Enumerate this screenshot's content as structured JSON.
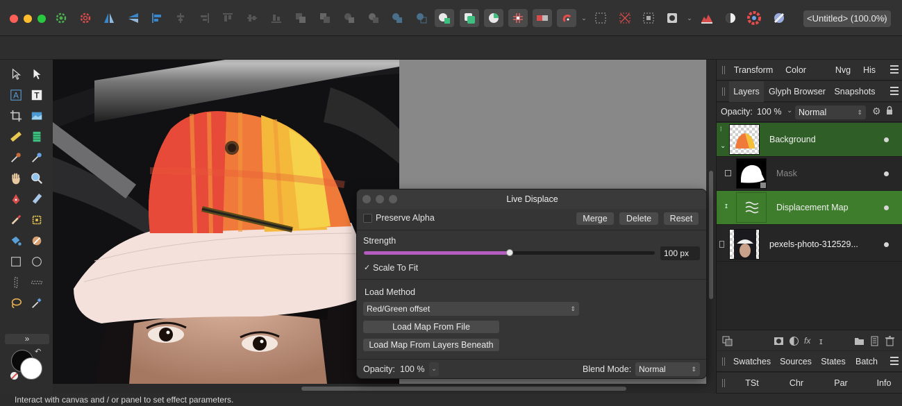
{
  "document_tab": {
    "title": "<Untitled> (100.0%)",
    "close": "×"
  },
  "status_bar": {
    "text": "Interact with canvas and / or panel to set effect parameters."
  },
  "tools_panel": {
    "expand_label": "»"
  },
  "right_panel": {
    "top_tabs": [
      "Transform",
      "Color",
      "Nvg",
      "His"
    ],
    "layers_tabs": [
      "Layers",
      "Glyph Browser",
      "Snapshots"
    ],
    "opacity_label": "Opacity:",
    "opacity_value": "100 %",
    "blend_value": "Normal",
    "layers": [
      {
        "name": "Background"
      },
      {
        "name": "Mask"
      },
      {
        "name": "Displacement Map"
      },
      {
        "name": "pexels-photo-312529..."
      }
    ],
    "bottom_tabs_1": [
      "Swatches",
      "Sources",
      "States",
      "Batch"
    ],
    "bottom_tabs_2": [
      "TSt",
      "Chr",
      "Par",
      "Info"
    ]
  },
  "dialog": {
    "title": "Live Displace",
    "preserve_alpha_label": "Preserve Alpha",
    "preserve_alpha_checked": false,
    "merge_label": "Merge",
    "delete_label": "Delete",
    "reset_label": "Reset",
    "strength_label": "Strength",
    "strength_value": "100 px",
    "strength_fraction": 0.5,
    "scale_to_fit_check": "✓",
    "scale_to_fit_label": "Scale To Fit",
    "load_method_label": "Load Method",
    "load_method_value": "Red/Green offset",
    "load_map_file_label": "Load Map From File",
    "load_map_layers_label": "Load Map From Layers Beneath",
    "opacity_label": "Opacity:",
    "opacity_value": "100 %",
    "blend_mode_label": "Blend Mode:",
    "blend_mode_value": "Normal"
  },
  "colors": {
    "slider_fill": "#b55dc0",
    "layer_selected": "#2f5e27",
    "layer_selected_bright": "#3e7d2c"
  }
}
